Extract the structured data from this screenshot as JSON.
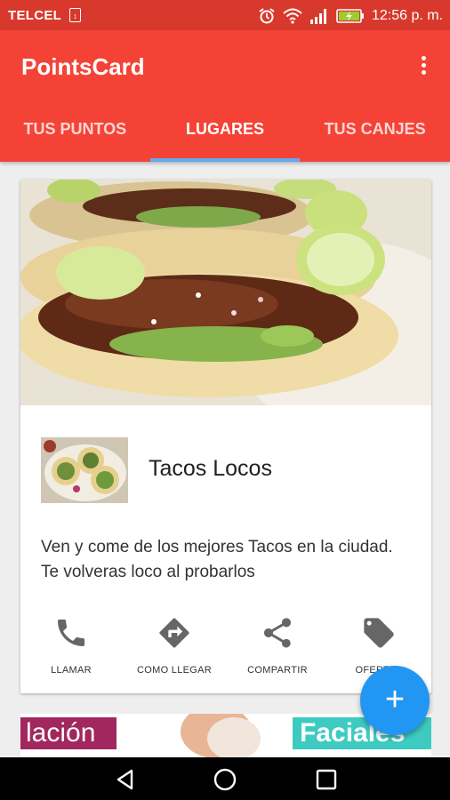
{
  "status_bar": {
    "carrier": "TELCEL",
    "sim_icon": "sim-icon",
    "icons": [
      "alarm-icon",
      "wifi-icon",
      "signal-icon",
      "battery-charging-icon"
    ],
    "time": "12:56 p. m."
  },
  "app_bar": {
    "title": "PointsCard",
    "menu_icon": "overflow-menu-icon"
  },
  "tabs": [
    {
      "label": "TUS PUNTOS",
      "selected": false
    },
    {
      "label": "LUGARES",
      "selected": true
    },
    {
      "label": "TUS CANJES",
      "selected": false
    }
  ],
  "place_card": {
    "name": "Tacos Locos",
    "description": "Ven y come de los mejores Tacos en la ciudad. Te volveras loco al probarlos",
    "actions": [
      {
        "label": "LLAMAR",
        "icon": "phone-icon"
      },
      {
        "label": "COMO LLEGAR",
        "icon": "directions-icon"
      },
      {
        "label": "COMPARTIR",
        "icon": "share-icon"
      },
      {
        "label": "OFERTAS",
        "icon": "tag-icon"
      }
    ]
  },
  "fab": {
    "label": "+",
    "icon": "add-icon"
  },
  "next_card": {
    "banner_left": "lación",
    "banner_right": "Faciales"
  },
  "colors": {
    "status_bar": "#d8392c",
    "app_bar": "#f44336",
    "tab_indicator": "#64a9ef",
    "fab": "#2196f3"
  }
}
